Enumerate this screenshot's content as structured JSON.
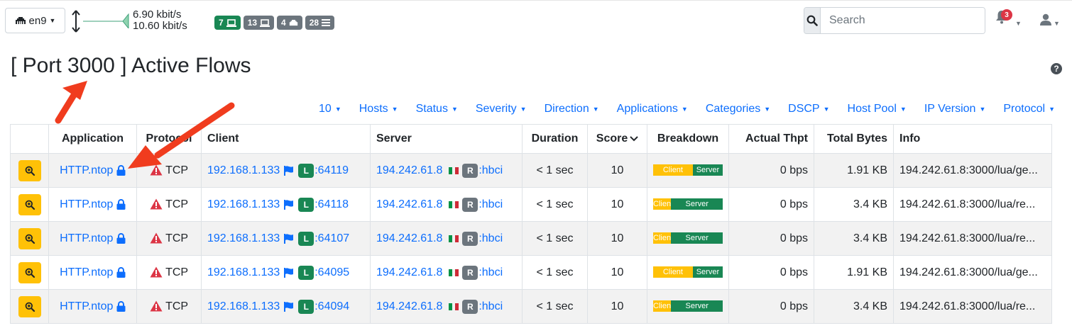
{
  "topbar": {
    "interface": "en9",
    "rate_up": "6.90 kbit/s",
    "rate_down": "10.60 kbit/s",
    "badges": [
      {
        "count": "7",
        "color": "#198754",
        "icon": "laptop-icon"
      },
      {
        "count": "13",
        "color": "#6c757d",
        "icon": "laptop-icon"
      },
      {
        "count": "4",
        "color": "#6c757d",
        "icon": "ethernet-icon"
      },
      {
        "count": "28",
        "color": "#6c757d",
        "icon": "list-icon"
      }
    ],
    "search_placeholder": "Search",
    "notifications": "3"
  },
  "page": {
    "title": "[ Port 3000 ] Active Flows",
    "help": "?"
  },
  "filters": [
    "10",
    "Hosts",
    "Status",
    "Severity",
    "Direction",
    "Applications",
    "Categories",
    "DSCP",
    "Host Pool",
    "IP Version",
    "Protocol"
  ],
  "table": {
    "headers": {
      "actions": "",
      "application": "Application",
      "protocol": "Protocol",
      "client": "Client",
      "server": "Server",
      "duration": "Duration",
      "score": "Score",
      "breakdown": "Breakdown",
      "thpt": "Actual Thpt",
      "bytes": "Total Bytes",
      "info": "Info"
    },
    "rows": [
      {
        "app": "HTTP.ntop",
        "proto": "TCP",
        "client_ip": "192.168.1.133",
        "client_badge": "L",
        "client_port": ":64119",
        "server_ip": "194.242.61.8",
        "server_badge": "R",
        "server_port": ":hbci",
        "duration": "< 1 sec",
        "score": "10",
        "client_label": "Client",
        "server_label": "Server",
        "client_pct": 57,
        "thpt": "0 bps",
        "bytes": "1.91 KB",
        "info": "194.242.61.8:3000/lua/ge..."
      },
      {
        "app": "HTTP.ntop",
        "proto": "TCP",
        "client_ip": "192.168.1.133",
        "client_badge": "L",
        "client_port": ":64118",
        "server_ip": "194.242.61.8",
        "server_badge": "R",
        "server_port": ":hbci",
        "duration": "< 1 sec",
        "score": "10",
        "client_label": "Client",
        "server_label": "Server",
        "client_pct": 26,
        "thpt": "0 bps",
        "bytes": "3.4 KB",
        "info": "194.242.61.8:3000/lua/re..."
      },
      {
        "app": "HTTP.ntop",
        "proto": "TCP",
        "client_ip": "192.168.1.133",
        "client_badge": "L",
        "client_port": ":64107",
        "server_ip": "194.242.61.8",
        "server_badge": "R",
        "server_port": ":hbci",
        "duration": "< 1 sec",
        "score": "10",
        "client_label": "Client",
        "server_label": "Server",
        "client_pct": 26,
        "thpt": "0 bps",
        "bytes": "3.4 KB",
        "info": "194.242.61.8:3000/lua/re..."
      },
      {
        "app": "HTTP.ntop",
        "proto": "TCP",
        "client_ip": "192.168.1.133",
        "client_badge": "L",
        "client_port": ":64095",
        "server_ip": "194.242.61.8",
        "server_badge": "R",
        "server_port": ":hbci",
        "duration": "< 1 sec",
        "score": "10",
        "client_label": "Client",
        "server_label": "Server",
        "client_pct": 57,
        "thpt": "0 bps",
        "bytes": "1.91 KB",
        "info": "194.242.61.8:3000/lua/ge..."
      },
      {
        "app": "HTTP.ntop",
        "proto": "TCP",
        "client_ip": "192.168.1.133",
        "client_badge": "L",
        "client_port": ":64094",
        "server_ip": "194.242.61.8",
        "server_badge": "R",
        "server_port": ":hbci",
        "duration": "< 1 sec",
        "score": "10",
        "client_label": "Client",
        "server_label": "Server",
        "client_pct": 26,
        "thpt": "0 bps",
        "bytes": "3.4 KB",
        "info": "194.242.61.8:3000/lua/re..."
      }
    ]
  },
  "colors": {
    "link": "#0d6efd",
    "warning": "#ffc107",
    "success": "#198754",
    "danger": "#dc3545",
    "annotation_arrow": "#f03c1e"
  }
}
